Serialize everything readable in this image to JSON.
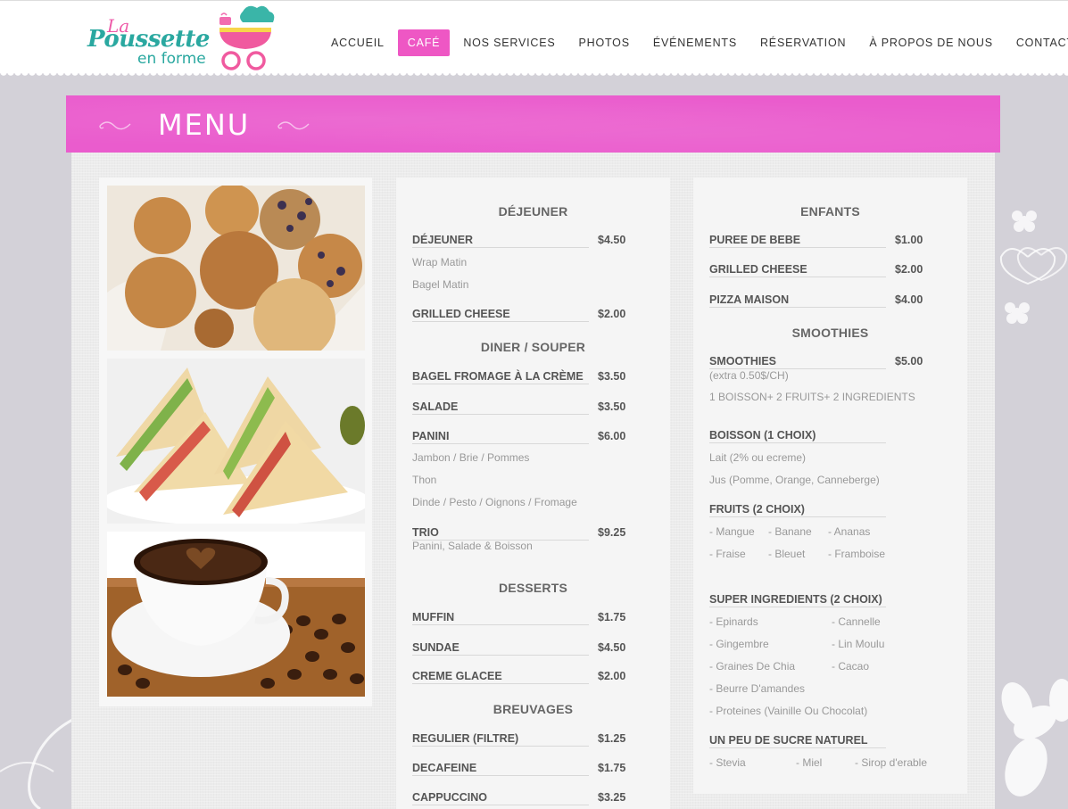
{
  "logo": {
    "la": "La",
    "poussette": "Poussette",
    "forme": "en forme"
  },
  "nav": [
    "ACCUEIL",
    "CAFÉ",
    "NOS SERVICES",
    "PHOTOS",
    "ÉVÉNEMENTS",
    "RÉSERVATION",
    "À PROPOS DE NOUS",
    "CONTACT"
  ],
  "active_nav": "CAFÉ",
  "banner": {
    "title": "MENU"
  },
  "colors": {
    "pink": "#ea5ccd",
    "nav_active": "#ee57c4",
    "teal": "#2aa8a0"
  },
  "photos": [
    "muffins-photo",
    "sandwich-photo",
    "coffee-photo"
  ],
  "middle": {
    "dejeuner_title": "DÉJEUNER",
    "dejeuner": {
      "name": "DÉJEUNER",
      "price": "$4.50",
      "subs": [
        "Wrap Matin",
        "Bagel Matin"
      ]
    },
    "grilled": {
      "name": "GRILLED CHEESE",
      "price": "$2.00"
    },
    "diner_title": "DINER / SOUPER",
    "bagel": {
      "name": "BAGEL FROMAGE À LA CRÈME",
      "price": "$3.50"
    },
    "salade": {
      "name": "SALADE",
      "price": "$3.50"
    },
    "panini": {
      "name": "PANINI",
      "price": "$6.00",
      "subs": [
        "Jambon / Brie / Pommes",
        "Thon",
        "Dinde / Pesto / Oignons / Fromage"
      ]
    },
    "trio": {
      "name": "TRIO",
      "price": "$9.25",
      "sub": "Panini, Salade & Boisson"
    },
    "desserts_title": "DESSERTS",
    "muffin": {
      "name": "MUFFIN",
      "price": "$1.75"
    },
    "sundae": {
      "name": "SUNDAE",
      "price": "$4.50"
    },
    "creme": {
      "name": "CREME GLACEE",
      "price": "$2.00"
    },
    "breuvages_title": "BREUVAGES",
    "regulier": {
      "name": "REGULIER (FILTRE)",
      "price": "$1.25"
    },
    "decafeine": {
      "name": "DECAFEINE",
      "price": "$1.75"
    },
    "cappuccino": {
      "name": "CAPPUCCINO",
      "price": "$3.25"
    }
  },
  "right": {
    "enfants_title": "ENFANTS",
    "puree": {
      "name": "PUREE DE BEBE",
      "price": "$1.00"
    },
    "grilled": {
      "name": "GRILLED CHEESE",
      "price": "$2.00"
    },
    "pizza": {
      "name": "PIZZA MAISON",
      "price": "$4.00"
    },
    "smoothies_title": "SMOOTHIES",
    "smoothies": {
      "name": "SMOOTHIES",
      "price": "$5.00",
      "extra": "(extra 0.50$/CH)",
      "desc": "1 BOISSON+ 2 FRUITS+ 2 INGREDIENTS"
    },
    "boisson": {
      "name": "BOISSON (1 CHOIX)",
      "subs": [
        "Lait (2% ou ecreme)",
        "Jus (Pomme, Orange, Canneberge)"
      ]
    },
    "fruits": {
      "name": "FRUITS (2 CHOIX)",
      "row1": [
        "- Mangue",
        "- Banane",
        "- Ananas"
      ],
      "row2": [
        "- Fraise",
        "- Bleuet",
        "- Framboise"
      ]
    },
    "super": {
      "name": "SUPER INGREDIENTS (2 CHOIX)",
      "left": [
        "- Epinards",
        "- Gingembre",
        "- Graines De Chia",
        "- Beurre D'amandes",
        "- Proteines (Vainille Ou Chocolat)"
      ],
      "right": [
        "- Cannelle",
        "- Lin Moulu",
        "- Cacao"
      ]
    },
    "sucre": {
      "name": "UN PEU DE SUCRE NATUREL",
      "items": [
        "- Stevia",
        "- Miel",
        "- Sirop d'erable"
      ]
    }
  }
}
